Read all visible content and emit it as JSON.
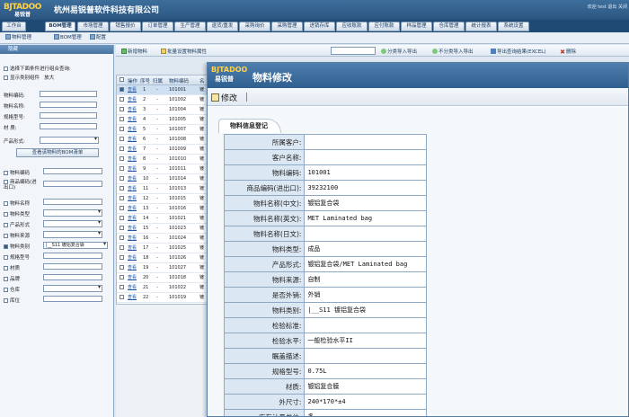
{
  "header": {
    "logo_text": "BJTADOO",
    "logo_sub": "易锐普",
    "company": "杭州易锐普软件科技有限公司",
    "user_info": "欢迎  test  退出  关闭"
  },
  "nav": {
    "tabs": [
      "工作台",
      "BOM管理",
      "市场管理",
      "销售报价",
      "订单管理",
      "生产管理",
      "退货/重发",
      "采购询价",
      "采购管理",
      "进销存库",
      "应收账款",
      "应付账款",
      "样品管理",
      "仓库管理",
      "统计报表",
      "系统设置"
    ]
  },
  "subnav": {
    "tabs": [
      "物料管理",
      "BOM管理",
      "配置"
    ]
  },
  "left_panel": {
    "title": "隐藏",
    "hint": "选择下面条件进行组合查询:",
    "show_category": "显示类别组件",
    "show_category_extra": "放大",
    "fields": [
      {
        "label": "物料编码:"
      },
      {
        "label": "物料名称:"
      },
      {
        "label": "规格型号:"
      },
      {
        "label": "材    质:"
      }
    ],
    "product_form_label": "产品形式:",
    "query_button": "查看该物料的BOM清单",
    "filters": [
      {
        "label": "物料编码",
        "checked": false
      },
      {
        "label": "商品编码(进出口)",
        "checked": false
      },
      {
        "label": "物料名称",
        "checked": false
      },
      {
        "label": "物料类型",
        "checked": false
      },
      {
        "label": "产品形式",
        "checked": false
      },
      {
        "label": "物料来源",
        "checked": false
      },
      {
        "label": "物料类别",
        "checked": true,
        "value": "|__S11 镀铝复合袋"
      },
      {
        "label": "规格型号",
        "checked": false
      },
      {
        "label": "材质",
        "checked": false
      },
      {
        "label": "品牌",
        "checked": false
      },
      {
        "label": "仓库",
        "checked": false
      },
      {
        "label": "库位",
        "checked": false
      }
    ]
  },
  "toolbar": {
    "items": [
      "新增物料",
      "批量设置物料属性",
      "分类导入导出",
      "不分类导入导出",
      "导出查询结果(EXCEL)",
      "删除"
    ]
  },
  "grid": {
    "headers": [
      "操作",
      "序号",
      "归属",
      "物料编码",
      "名"
    ],
    "link_label": "查看",
    "rows": [
      {
        "index": "1",
        "owner": "-",
        "code": "101001",
        "name": "镀"
      },
      {
        "index": "2",
        "owner": "-",
        "code": "101002",
        "name": "镀"
      },
      {
        "index": "3",
        "owner": "-",
        "code": "101004",
        "name": "镀"
      },
      {
        "index": "4",
        "owner": "-",
        "code": "101005",
        "name": "镀"
      },
      {
        "index": "5",
        "owner": "-",
        "code": "101007",
        "name": "镀"
      },
      {
        "index": "6",
        "owner": "-",
        "code": "101008",
        "name": "镀"
      },
      {
        "index": "7",
        "owner": "-",
        "code": "101009",
        "name": "镀"
      },
      {
        "index": "8",
        "owner": "-",
        "code": "101010",
        "name": "镀"
      },
      {
        "index": "9",
        "owner": "-",
        "code": "101011",
        "name": "镀"
      },
      {
        "index": "10",
        "owner": "-",
        "code": "101014",
        "name": "镀"
      },
      {
        "index": "11",
        "owner": "-",
        "code": "101013",
        "name": "镀"
      },
      {
        "index": "12",
        "owner": "-",
        "code": "101015",
        "name": "镀"
      },
      {
        "index": "13",
        "owner": "-",
        "code": "101016",
        "name": "镀"
      },
      {
        "index": "14",
        "owner": "-",
        "code": "101021",
        "name": "镀"
      },
      {
        "index": "15",
        "owner": "-",
        "code": "101023",
        "name": "镀"
      },
      {
        "index": "16",
        "owner": "-",
        "code": "101024",
        "name": "镀"
      },
      {
        "index": "17",
        "owner": "-",
        "code": "101025",
        "name": "镀"
      },
      {
        "index": "18",
        "owner": "-",
        "code": "101026",
        "name": "镀"
      },
      {
        "index": "19",
        "owner": "-",
        "code": "101027",
        "name": "镀"
      },
      {
        "index": "20",
        "owner": "-",
        "code": "101018",
        "name": "镀"
      },
      {
        "index": "21",
        "owner": "-",
        "code": "101022",
        "name": "镀"
      },
      {
        "index": "22",
        "owner": "-",
        "code": "101019",
        "name": "镀"
      }
    ]
  },
  "modal": {
    "logo_text": "BJTADOO",
    "logo_sub": "易锐普",
    "title": "物料修改",
    "edit_button": "修改",
    "section_title": "物料信息登记",
    "rows": [
      {
        "label": "所属客户:",
        "value": ""
      },
      {
        "label": "客户名称:",
        "value": ""
      },
      {
        "label": "物料编码:",
        "value": "101001"
      },
      {
        "label": "商品编码(进出口):",
        "value": "39232100"
      },
      {
        "label": "物料名称(中文):",
        "value": "镀铝复合袋"
      },
      {
        "label": "物料名称(英文):",
        "value": "MET Laminated bag"
      },
      {
        "label": "物料名称(日文):",
        "value": ""
      },
      {
        "label": "物料类型:",
        "value": "成品"
      },
      {
        "label": "产品形式:",
        "value": "镀铝复合袋/MET Laminated bag"
      },
      {
        "label": "物料来源:",
        "value": "自制"
      },
      {
        "label": "是否外销:",
        "value": "外销"
      },
      {
        "label": "物料类别:",
        "value": "|__S11 镀铝复合袋"
      },
      {
        "label": "检验标准:",
        "value": ""
      },
      {
        "label": "检验水平:",
        "value": "一般检验水平II"
      },
      {
        "label": "瞩盖描述:",
        "value": ""
      },
      {
        "label": "规格型号:",
        "value": "0.75L"
      },
      {
        "label": "材质:",
        "value": "镀铝复合膜"
      },
      {
        "label": "外尺寸:",
        "value": "240*170*±4"
      },
      {
        "label": "库存计量单位:",
        "value": "条"
      }
    ]
  }
}
